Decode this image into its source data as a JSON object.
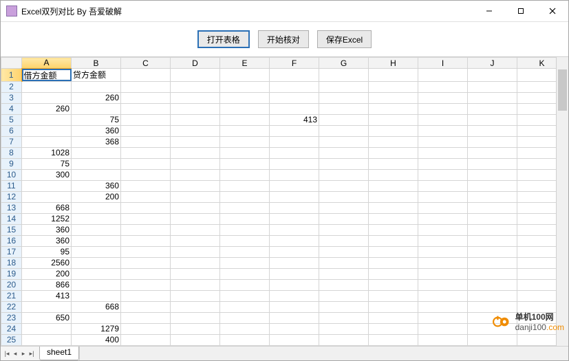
{
  "window": {
    "title": "Excel双列对比 By 吾爱破解"
  },
  "toolbar": {
    "open_label": "打开表格",
    "compare_label": "开始核对",
    "save_label": "保存Excel"
  },
  "grid": {
    "columns": [
      "A",
      "B",
      "C",
      "D",
      "E",
      "F",
      "G",
      "H",
      "I",
      "J",
      "K"
    ],
    "column_widths": {
      "row_head": 30,
      "first": 72,
      "other": 72
    },
    "selected_column_index": 0,
    "active_cell": {
      "row": 1,
      "col": 0
    },
    "rows": [
      {
        "n": 1,
        "A": "借方金额",
        "B": "贷方金额"
      },
      {
        "n": 2
      },
      {
        "n": 3,
        "B": "260"
      },
      {
        "n": 4,
        "A": "260"
      },
      {
        "n": 5,
        "B": "75",
        "F": "413"
      },
      {
        "n": 6,
        "B": "360"
      },
      {
        "n": 7,
        "B": "368"
      },
      {
        "n": 8,
        "A": "1028"
      },
      {
        "n": 9,
        "A": "75"
      },
      {
        "n": 10,
        "A": "300"
      },
      {
        "n": 11,
        "B": "360"
      },
      {
        "n": 12,
        "B": "200"
      },
      {
        "n": 13,
        "A": "668"
      },
      {
        "n": 14,
        "A": "1252"
      },
      {
        "n": 15,
        "A": "360"
      },
      {
        "n": 16,
        "A": "360"
      },
      {
        "n": 17,
        "A": "95"
      },
      {
        "n": 18,
        "A": "2560"
      },
      {
        "n": 19,
        "A": "200"
      },
      {
        "n": 20,
        "A": "866"
      },
      {
        "n": 21,
        "A": "413"
      },
      {
        "n": 22,
        "B": "668"
      },
      {
        "n": 23,
        "A": "650"
      },
      {
        "n": 24,
        "B": "1279"
      },
      {
        "n": 25,
        "B": "400"
      }
    ]
  },
  "sheets": {
    "tabs": [
      "sheet1"
    ],
    "active": "sheet1"
  },
  "watermark": {
    "brand": "单机100网",
    "domain_pre": "danji100",
    "domain_accent": ".com"
  }
}
